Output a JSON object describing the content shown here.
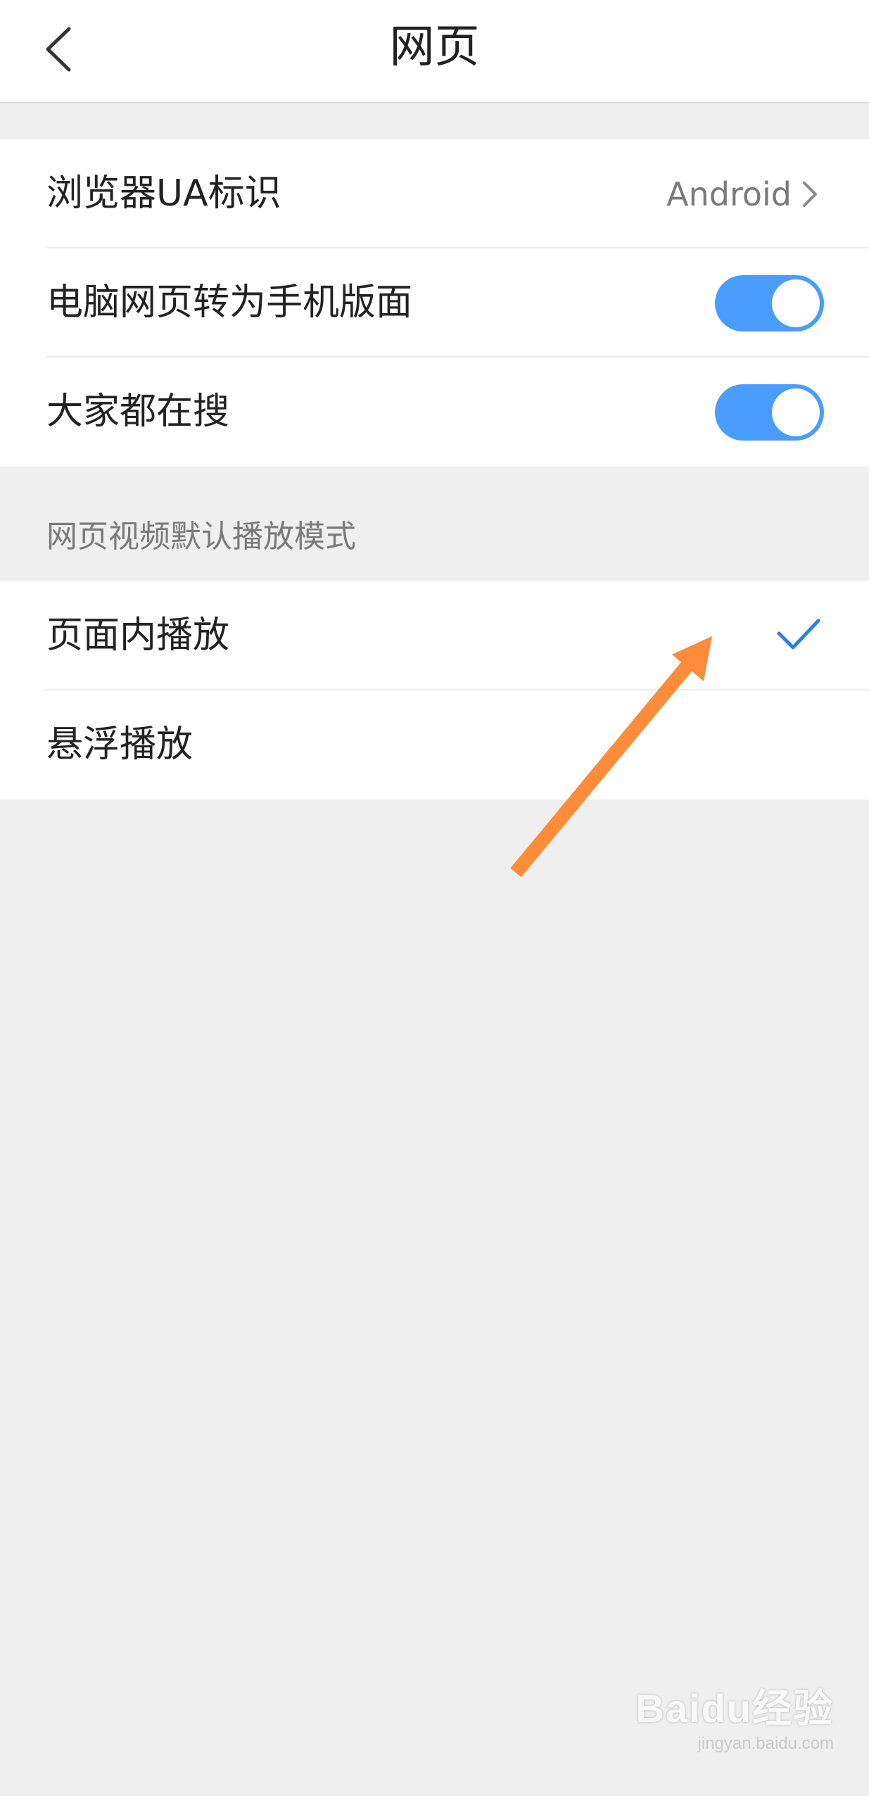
{
  "header": {
    "title": "网页"
  },
  "settings_group": {
    "items": [
      {
        "label": "浏览器UA标识",
        "value": "Android"
      },
      {
        "label": "电脑网页转为手机版面",
        "toggle_on": true
      },
      {
        "label": "大家都在搜",
        "toggle_on": true
      }
    ]
  },
  "video_section": {
    "title": "网页视频默认播放模式",
    "options": [
      {
        "label": "页面内播放",
        "selected": true
      },
      {
        "label": "悬浮播放",
        "selected": false
      }
    ]
  },
  "annotation": {
    "arrow_color": "#ff8c3a"
  },
  "colors": {
    "accent": "#4a9cff",
    "check": "#2f7de1"
  },
  "watermark": {
    "brand": "Baidu经验",
    "url": "jingyan.baidu.com"
  }
}
